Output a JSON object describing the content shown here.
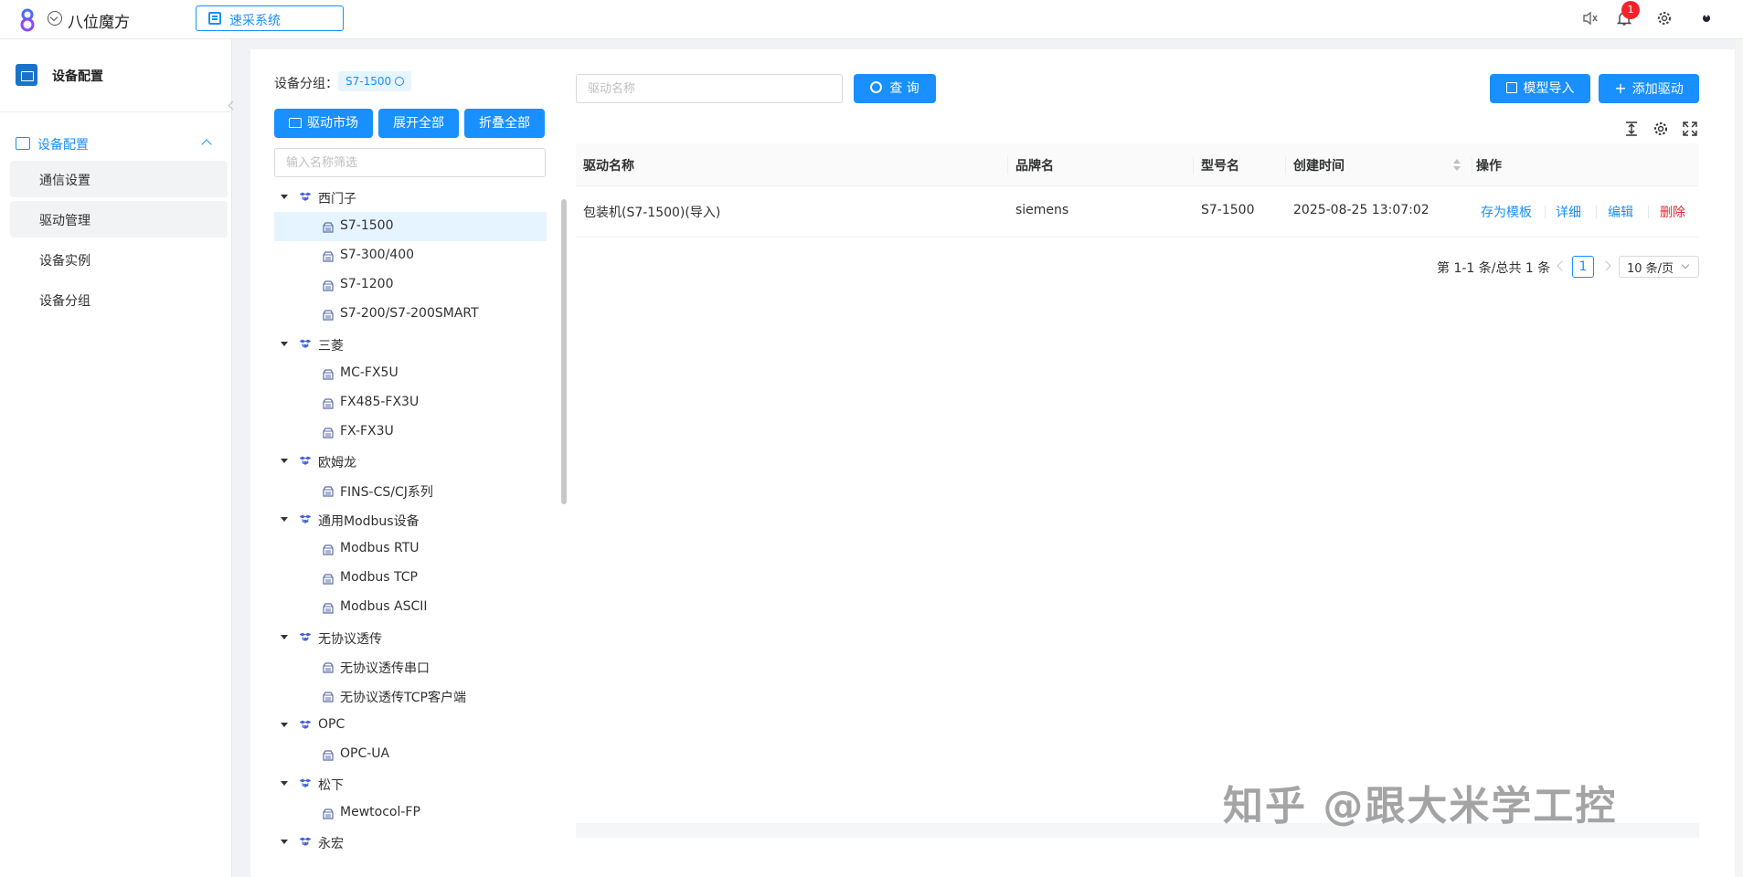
{
  "topbar": {
    "brand_name": "八位魔方",
    "system_select": "速采系统",
    "notification_count": "1"
  },
  "sidebar": {
    "header_title": "设备配置",
    "group_label": "设备配置",
    "items": [
      {
        "label": "通信设置"
      },
      {
        "label": "驱动管理"
      },
      {
        "label": "设备实例"
      },
      {
        "label": "设备分组"
      }
    ]
  },
  "tree_panel": {
    "group_label": "设备分组：",
    "group_tag": "S7-1500",
    "buttons": {
      "market": "驱动市场",
      "expand_all": "展开全部",
      "collapse_all": "折叠全部"
    },
    "filter_placeholder": "输入名称筛选",
    "nodes": [
      {
        "label": "西门子",
        "level": 0
      },
      {
        "label": "S7-1500",
        "level": 1,
        "selected": true
      },
      {
        "label": "S7-300/400",
        "level": 1
      },
      {
        "label": "S7-1200",
        "level": 1
      },
      {
        "label": "S7-200/S7-200SMART",
        "level": 1
      },
      {
        "label": "三菱",
        "level": 0
      },
      {
        "label": "MC-FX5U",
        "level": 1
      },
      {
        "label": "FX485-FX3U",
        "level": 1
      },
      {
        "label": "FX-FX3U",
        "level": 1
      },
      {
        "label": "欧姆龙",
        "level": 0
      },
      {
        "label": "FINS-CS/CJ系列",
        "level": 1
      },
      {
        "label": "通用Modbus设备",
        "level": 0
      },
      {
        "label": "Modbus RTU",
        "level": 1
      },
      {
        "label": "Modbus TCP",
        "level": 1
      },
      {
        "label": "Modbus ASCII",
        "level": 1
      },
      {
        "label": "无协议透传",
        "level": 0
      },
      {
        "label": "无协议透传串口",
        "level": 1
      },
      {
        "label": "无协议透传TCP客户端",
        "level": 1
      },
      {
        "label": "OPC",
        "level": 0
      },
      {
        "label": "OPC-UA",
        "level": 1
      },
      {
        "label": "松下",
        "level": 0
      },
      {
        "label": "Mewtocol-FP",
        "level": 1
      },
      {
        "label": "永宏",
        "level": 0
      }
    ]
  },
  "content": {
    "search_placeholder": "驱动名称",
    "search_button": "查 询",
    "import_button": "模型导入",
    "add_button": "添加驱动",
    "table": {
      "columns": [
        "驱动名称",
        "品牌名",
        "型号名",
        "创建时间",
        "操作"
      ],
      "rows": [
        {
          "driver_name": "包装机(S7-1500)(导入)",
          "brand": "siemens",
          "model": "S7-1500",
          "created": "2025-08-25 13:07:02",
          "actions": [
            "存为模板",
            "详细",
            "编辑",
            "删除"
          ]
        }
      ]
    },
    "pagination": {
      "total_text": "第 1-1 条/总共 1 条",
      "current_page": "1",
      "page_size": "10 条/页"
    }
  },
  "watermark": "知乎 @跟大米学工控",
  "colors": {
    "primary": "#1890ff",
    "danger": "#f5222d",
    "selected_row": "#e6f4ff"
  }
}
